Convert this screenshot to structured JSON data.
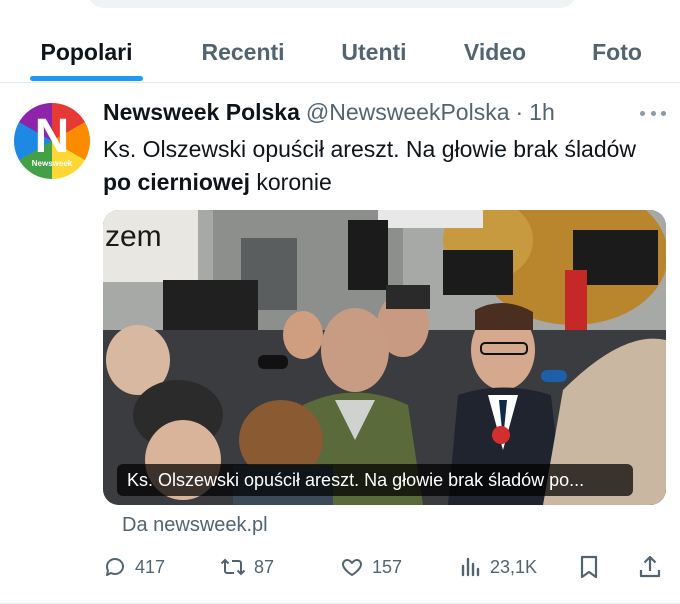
{
  "tabs": [
    {
      "label": "Popolari",
      "active": true
    },
    {
      "label": "Recenti",
      "active": false
    },
    {
      "label": "Utenti",
      "active": false
    },
    {
      "label": "Video",
      "active": false
    },
    {
      "label": "Foto",
      "active": false
    }
  ],
  "tweet": {
    "avatar": {
      "letter": "N",
      "word": "Newsweek"
    },
    "display_name": "Newsweek Polska",
    "handle": "@NewsweekPolska",
    "separator": "·",
    "time": "1h",
    "text_part1": "Ks. Olszewski opuścił areszt. Na głowie brak śladów ",
    "text_bold": "po cierniowej",
    "text_part2": " koronie",
    "media": {
      "banner_text": "zem",
      "caption": "Ks. Olszewski opuścił areszt. Na głowie brak śladów po..."
    },
    "source": "Da newsweek.pl",
    "stats": {
      "replies": "417",
      "reposts": "87",
      "likes": "157",
      "views": "23,1K"
    }
  },
  "colors": {
    "accent": "#1d9bf0",
    "text_primary": "#0f1419",
    "text_secondary": "#536471"
  },
  "icons": [
    "more-icon",
    "reply-icon",
    "repost-icon",
    "like-icon",
    "views-icon",
    "bookmark-icon",
    "share-icon"
  ]
}
